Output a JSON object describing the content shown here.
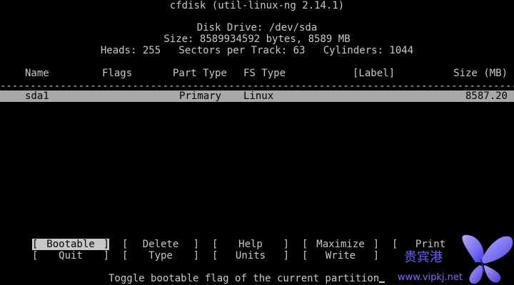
{
  "header": {
    "title": "cfdisk (util-linux-ng 2.14.1)",
    "disk_drive": "Disk Drive: /dev/sda",
    "size": "Size: 8589934592 bytes, 8589 MB",
    "geometry": "Heads: 255   Sectors per Track: 63   Cylinders: 1044"
  },
  "columns": {
    "name": "Name",
    "flags": "Flags",
    "part_type": "Part Type",
    "fs_type": "FS Type",
    "label": "[Label]",
    "size": "Size (MB)"
  },
  "partitions": [
    {
      "name": "sda1",
      "flags": "",
      "part_type": "Primary",
      "fs_type": "Linux",
      "label": "",
      "size": "8587.20"
    }
  ],
  "menu": {
    "bootable": "Bootable",
    "delete": "Delete",
    "help": "Help",
    "maximize": "Maximize",
    "print": "Print",
    "quit": "Quit",
    "type": "Type",
    "units": "Units",
    "write": "Write"
  },
  "hint": "Toggle bootable flag of the current partition",
  "watermark": {
    "text_cn": "贵宾港",
    "url": "www.vipkj.net",
    "icon": "butterfly-logo",
    "color": "#6a5cff"
  },
  "colors": {
    "background": "#000000",
    "foreground": "#c8c8c8",
    "highlight": "#a8a8a8"
  }
}
